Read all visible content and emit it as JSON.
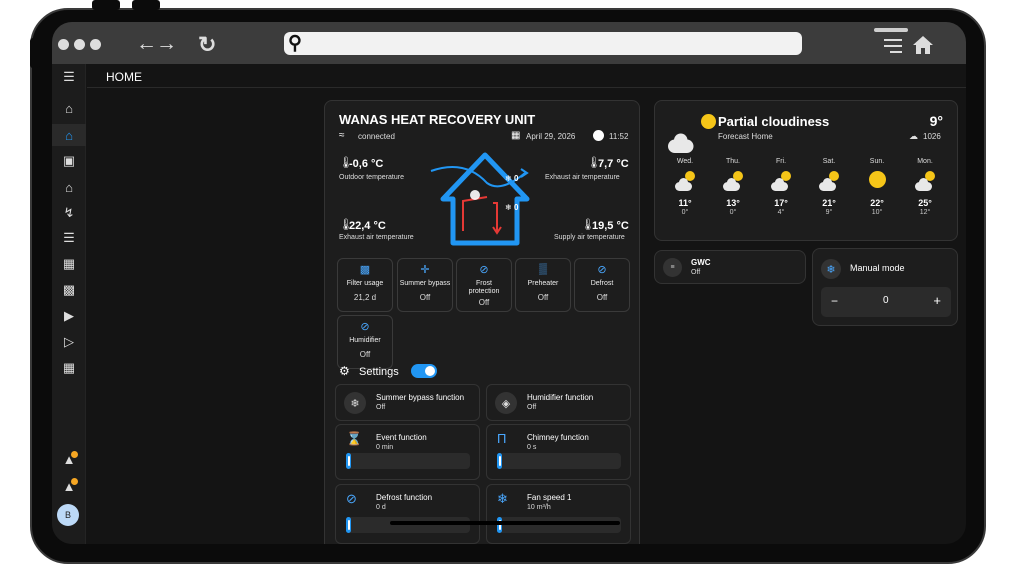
{
  "browser": {
    "url": ""
  },
  "header": {
    "title": "HOME"
  },
  "sidebar": {
    "avatar": "B"
  },
  "unit": {
    "title": "WANAS HEAT RECOVERY UNIT",
    "status": "connected",
    "date": "April 29, 2026",
    "time": "11:52",
    "outdoor_temp": "-0,6 °C",
    "outdoor_label": "Outdoor temperature",
    "exhaust_top_temp": "7,7 °C",
    "exhaust_top_label": "Exhaust air temperature",
    "exhaust_bottom_temp": "22,4 °C",
    "exhaust_bottom_label": "Exhaust air temperature",
    "supply_temp": "19,5 °C",
    "supply_label": "Supply air temperature",
    "fan_top": "0",
    "fan_bottom": "0",
    "tiles": [
      {
        "label": "Filter usage",
        "value": "21,2 d"
      },
      {
        "label": "Summer bypass",
        "value": "Off"
      },
      {
        "label": "Frost protection",
        "value": "Off"
      },
      {
        "label": "Preheater",
        "value": "Off"
      },
      {
        "label": "Defrost",
        "value": "Off"
      },
      {
        "label": "Humidifier",
        "value": "Off"
      }
    ],
    "settings_label": "Settings",
    "settings_toggle_on": true
  },
  "settings_cards": [
    {
      "title": "Summer bypass function",
      "value": "Off"
    },
    {
      "title": "Humidifier function",
      "value": "Off"
    },
    {
      "title": "Event function",
      "value": "0 min"
    },
    {
      "title": "Chimney function",
      "value": "0 s"
    },
    {
      "title": "Defrost function",
      "value": "0 d"
    },
    {
      "title": "Fan speed 1",
      "value": "10 m³/h"
    }
  ],
  "weather": {
    "condition": "Partial cloudiness",
    "location": "Forecast Home",
    "temp": "9°",
    "pressure": "1026",
    "days": [
      {
        "name": "Wed.",
        "high": "11°",
        "low": "0°",
        "icon": "partly-cloudy"
      },
      {
        "name": "Thu.",
        "high": "13°",
        "low": "0°",
        "icon": "partly-cloudy"
      },
      {
        "name": "Fri.",
        "high": "17°",
        "low": "4°",
        "icon": "partly-cloudy"
      },
      {
        "name": "Sat.",
        "high": "21°",
        "low": "9°",
        "icon": "partly-cloudy"
      },
      {
        "name": "Sun.",
        "high": "22°",
        "low": "10°",
        "icon": "sunny"
      },
      {
        "name": "Mon.",
        "high": "25°",
        "low": "12°",
        "icon": "partly-cloudy"
      }
    ]
  },
  "gwc": {
    "title": "GWC",
    "value": "Off"
  },
  "mode": {
    "title": "Manual mode",
    "value": "0",
    "minus": "−",
    "plus": "+"
  },
  "colors": {
    "accent": "#2196f3",
    "sun": "#f5c518",
    "notification": "#f5a623",
    "background": "#141414",
    "card": "#1d1d1d"
  }
}
